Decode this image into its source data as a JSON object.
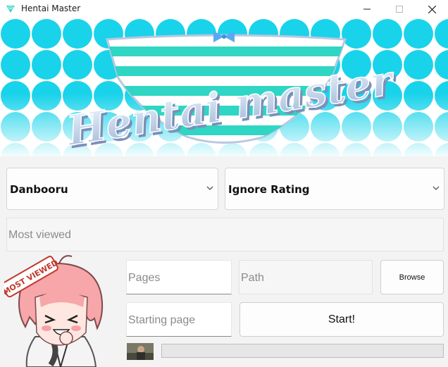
{
  "window": {
    "title": "Hentai Master"
  },
  "banner": {
    "logo_text": "Hentai master"
  },
  "source_select": {
    "value": "Danbooru"
  },
  "rating_select": {
    "value": "Ignore Rating"
  },
  "sort_field": {
    "placeholder": "Most viewed"
  },
  "pages_field": {
    "placeholder": "Pages"
  },
  "path_field": {
    "placeholder": "Path"
  },
  "start_page_field": {
    "placeholder": "Starting page"
  },
  "buttons": {
    "browse": "Browse",
    "start": "Start!"
  },
  "mascot": {
    "badge_text": "MOST VIEWED"
  },
  "progress": {
    "value": 0
  },
  "colors": {
    "accent_cyan": "#19d3ea",
    "stripe_teal": "#2fd6c4",
    "bow_blue": "#5aa9f0"
  }
}
